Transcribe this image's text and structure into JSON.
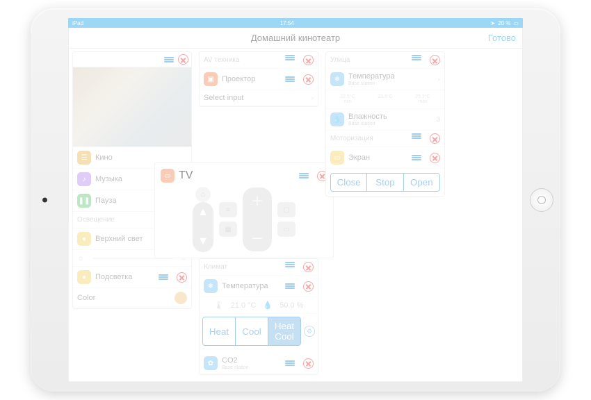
{
  "status": {
    "left": "iPad",
    "time": "17:54",
    "battery": "20 %"
  },
  "header": {
    "title": "Домашний кинотеатр",
    "done": "Готово"
  },
  "scenes": {
    "items": [
      {
        "label": "Кино",
        "color": "#e7b851"
      },
      {
        "label": "Музыка",
        "color": "#b98cf0"
      },
      {
        "label": "Пауза",
        "color": "#67c979"
      }
    ],
    "section_light": "Освещение",
    "light1": "Верхний свет",
    "light2": "Подсветка",
    "color": "Color"
  },
  "av": {
    "section": "AV техника",
    "projector": "Проектор",
    "select": "Select input"
  },
  "tv": {
    "label": "TV"
  },
  "climate": {
    "section": "Климат",
    "temp": "Температура",
    "t_val": "21.0 °C",
    "h_val": "50.0 %",
    "modes": [
      "Heat",
      "Cool",
      "Heat Cool"
    ],
    "co2": "CO2",
    "co2_sub": "Base station"
  },
  "street": {
    "section": "Улица",
    "temp": "Температура",
    "temp_sub": "Base station",
    "min_t": "22.5°C",
    "min_lab": "min",
    "cur_t": "23.8°C",
    "max_t": "25.2°C",
    "max_lab": "max",
    "hum": "Влажность",
    "hum_sub": "Base station",
    "hum_val": "3",
    "motor": "Моторизация",
    "screen": "Экран",
    "btns": [
      "Close",
      "Stop",
      "Open"
    ]
  }
}
